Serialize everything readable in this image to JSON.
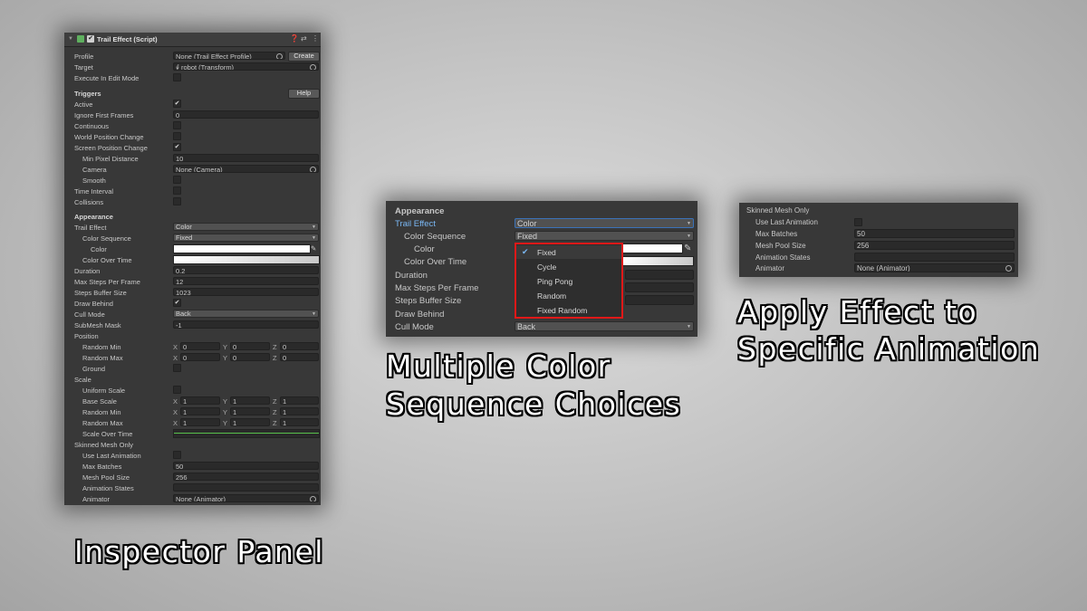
{
  "inspector": {
    "title": "Trail Effect (Script)",
    "header_icons": [
      "help-icon",
      "preset-icon",
      "more-icon"
    ],
    "profile_label": "Profile",
    "profile_value": "None (Trail Effect Profile)",
    "create_button": "Create",
    "target_label": "Target",
    "target_value": "⨚ robot (Transform)",
    "execute_label": "Execute In Edit Mode",
    "triggers_heading": "Triggers",
    "help_button": "Help",
    "active_label": "Active",
    "ignore_first_frames_label": "Ignore First Frames",
    "ignore_first_frames_value": "0",
    "continuous_label": "Continuous",
    "world_pos_label": "World Position Change",
    "screen_pos_label": "Screen Position Change",
    "min_pixel_label": "Min Pixel Distance",
    "min_pixel_value": "10",
    "camera_label": "Camera",
    "camera_value": "None (Camera)",
    "smooth_label": "Smooth",
    "time_interval_label": "Time Interval",
    "collisions_label": "Collisions",
    "appearance_heading": "Appearance",
    "trail_effect_label": "Trail Effect",
    "trail_effect_value": "Color",
    "color_sequence_label": "Color Sequence",
    "color_sequence_value": "Fixed",
    "color_label": "Color",
    "color_over_time_label": "Color Over Time",
    "duration_label": "Duration",
    "duration_value": "0.2",
    "max_steps_label": "Max Steps Per Frame",
    "max_steps_value": "12",
    "steps_buffer_label": "Steps Buffer Size",
    "steps_buffer_value": "1023",
    "draw_behind_label": "Draw Behind",
    "cull_mode_label": "Cull Mode",
    "cull_mode_value": "Back",
    "submesh_label": "SubMesh Mask",
    "submesh_value": "-1",
    "position_heading": "Position",
    "random_min_label": "Random Min",
    "random_max_label": "Random Max",
    "ground_label": "Ground",
    "scale_heading": "Scale",
    "uniform_scale_label": "Uniform Scale",
    "base_scale_label": "Base Scale",
    "scale_over_time_label": "Scale Over Time",
    "skinned_heading": "Skinned Mesh Only",
    "use_last_anim_label": "Use Last Animation",
    "max_batches_label": "Max Batches",
    "max_batches_value": "50",
    "mesh_pool_label": "Mesh Pool Size",
    "mesh_pool_value": "256",
    "anim_states_label": "Animation States",
    "animator_label": "Animator",
    "animator_value": "None (Animator)",
    "axis_x": "X",
    "axis_y": "Y",
    "axis_z": "Z",
    "zero": "0",
    "one": "1"
  },
  "middle": {
    "heading": "Appearance",
    "trail_effect_label": "Trail Effect",
    "trail_effect_value": "Color",
    "color_sequence_label": "Color Sequence",
    "color_sequence_value": "Fixed",
    "color_label": "Color",
    "color_over_time_label": "Color Over Time",
    "duration_label": "Duration",
    "max_steps_label": "Max Steps Per Frame",
    "steps_buffer_label": "Steps Buffer Size",
    "draw_behind_label": "Draw Behind",
    "cull_mode_label": "Cull Mode",
    "cull_mode_value": "Back",
    "dropdown_options": [
      "Fixed",
      "Cycle",
      "Ping Pong",
      "Random",
      "Fixed Random"
    ],
    "dropdown_selected": "Fixed",
    "highlight_color": "#e01818",
    "link_color": "#7ab8f5"
  },
  "right": {
    "heading": "Skinned Mesh Only",
    "use_last_anim_label": "Use Last Animation",
    "max_batches_label": "Max Batches",
    "max_batches_value": "50",
    "mesh_pool_label": "Mesh Pool Size",
    "mesh_pool_value": "256",
    "anim_states_label": "Animation States",
    "animator_label": "Animator",
    "animator_value": "None (Animator)"
  },
  "captions": {
    "inspector": "Inspector Panel",
    "middle_line1": "Multiple Color",
    "middle_line2": "Sequence Choices",
    "right_line1": "Apply Effect to",
    "right_line2": "Specific Animation"
  }
}
